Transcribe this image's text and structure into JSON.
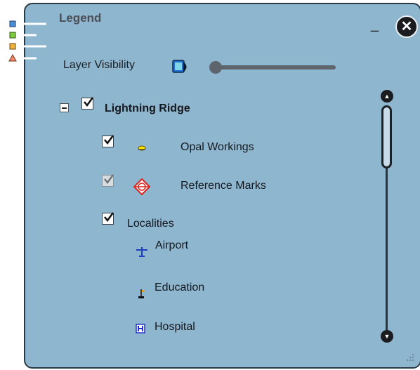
{
  "panel": {
    "title": "Legend",
    "minimize_label": "_",
    "close_label": "✕"
  },
  "layer_visibility": {
    "label": "Layer Visibility",
    "slider_value": 0.0
  },
  "tree": {
    "group": {
      "label": "Lightning Ridge",
      "checked": true,
      "expanded": true
    },
    "layers": [
      {
        "label": "Opal Workings",
        "checked": true,
        "icon": "opal-workings-icon"
      },
      {
        "label": "Reference Marks",
        "checked": true,
        "icon": "reference-marks-icon"
      },
      {
        "label": "Localities",
        "checked": true,
        "icon": null
      }
    ],
    "localities_items": [
      {
        "label": "Airport",
        "icon": "airport-icon"
      },
      {
        "label": "Education",
        "icon": "education-icon"
      },
      {
        "label": "Hospital",
        "icon": "hospital-icon"
      }
    ]
  },
  "scrollbar": {
    "up_label": "▲",
    "down_label": "▼"
  }
}
